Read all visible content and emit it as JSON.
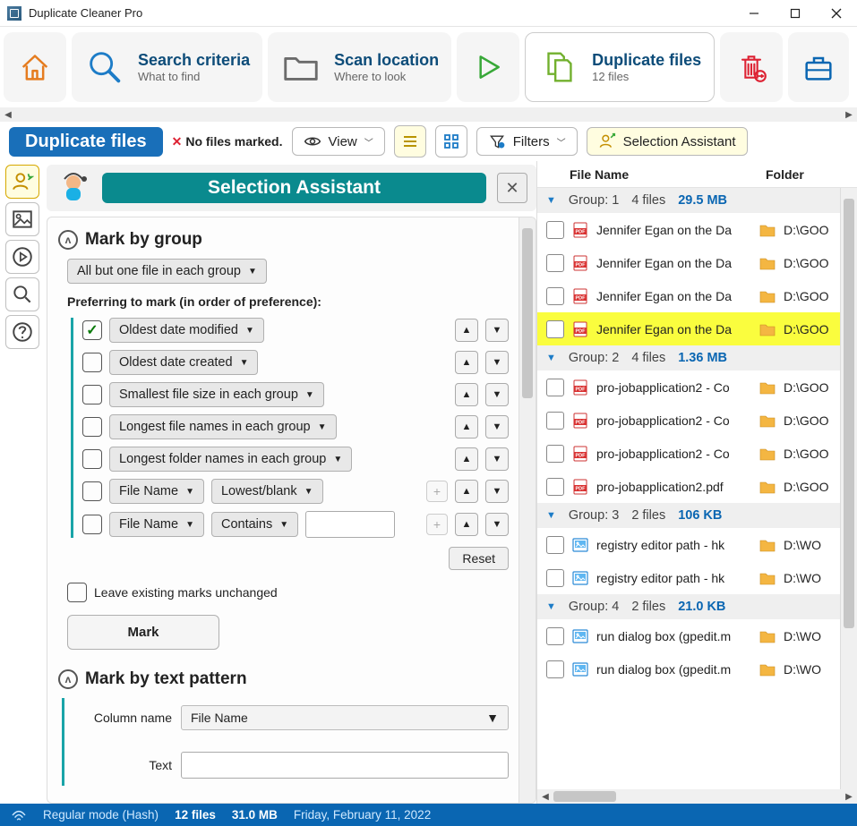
{
  "app": {
    "title": "Duplicate Cleaner Pro"
  },
  "toolbar": {
    "home": "Home",
    "search": {
      "title": "Search criteria",
      "sub": "What to find"
    },
    "location": {
      "title": "Scan location",
      "sub": "Where to look"
    },
    "duplicate": {
      "title": "Duplicate files",
      "sub": "12 files"
    }
  },
  "sec": {
    "chip": "Duplicate files",
    "marked": "No files marked.",
    "view": "View",
    "filters": "Filters",
    "selection": "Selection Assistant"
  },
  "sa": {
    "title": "Selection Assistant",
    "mark_by_group": "Mark by group",
    "group_combo": "All but one file in each group",
    "preferring": "Preferring to mark (in order of preference):",
    "rules": {
      "r1": "Oldest date modified",
      "r2": "Oldest date created",
      "r3": "Smallest file size in each group",
      "r4": "Longest file names in each group",
      "r5": "Longest folder names in each group",
      "r6a": "File Name",
      "r6b": "Lowest/blank",
      "r7a": "File Name",
      "r7b": "Contains"
    },
    "reset": "Reset",
    "leave": "Leave existing marks unchanged",
    "mark_btn": "Mark",
    "mark_by_text": "Mark by text pattern",
    "col_label": "Column name",
    "col_value": "File Name",
    "text_label": "Text"
  },
  "right": {
    "col_file": "File Name",
    "col_folder": "Folder",
    "groups": [
      {
        "name": "Group: 1",
        "count": "4 files",
        "size": "29.5 MB",
        "files": [
          {
            "type": "pdf",
            "name": "Jennifer Egan on the Da",
            "path": "D:\\GOO",
            "hi": false
          },
          {
            "type": "pdf",
            "name": "Jennifer Egan on the Da",
            "path": "D:\\GOO",
            "hi": false
          },
          {
            "type": "pdf",
            "name": "Jennifer Egan on the Da",
            "path": "D:\\GOO",
            "hi": false
          },
          {
            "type": "pdf",
            "name": "Jennifer Egan on the Da",
            "path": "D:\\GOO",
            "hi": true
          }
        ]
      },
      {
        "name": "Group: 2",
        "count": "4 files",
        "size": "1.36 MB",
        "files": [
          {
            "type": "pdf",
            "name": "pro-jobapplication2 - Co",
            "path": "D:\\GOO",
            "hi": false
          },
          {
            "type": "pdf",
            "name": "pro-jobapplication2 - Co",
            "path": "D:\\GOO",
            "hi": false
          },
          {
            "type": "pdf",
            "name": "pro-jobapplication2 - Co",
            "path": "D:\\GOO",
            "hi": false
          },
          {
            "type": "pdf",
            "name": "pro-jobapplication2.pdf",
            "path": "D:\\GOO",
            "hi": false
          }
        ]
      },
      {
        "name": "Group: 3",
        "count": "2 files",
        "size": "106 KB",
        "files": [
          {
            "type": "img",
            "name": "registry editor path - hk",
            "path": "D:\\WO",
            "hi": false
          },
          {
            "type": "img",
            "name": "registry editor path - hk",
            "path": "D:\\WO",
            "hi": false
          }
        ]
      },
      {
        "name": "Group: 4",
        "count": "2 files",
        "size": "21.0 KB",
        "files": [
          {
            "type": "img",
            "name": "run dialog box (gpedit.m",
            "path": "D:\\WO",
            "hi": false
          },
          {
            "type": "img",
            "name": "run dialog box (gpedit.m",
            "path": "D:\\WO",
            "hi": false
          }
        ]
      }
    ]
  },
  "status": {
    "mode": "Regular mode (Hash)",
    "files": "12 files",
    "size": "31.0 MB",
    "date": "Friday, February 11, 2022"
  }
}
